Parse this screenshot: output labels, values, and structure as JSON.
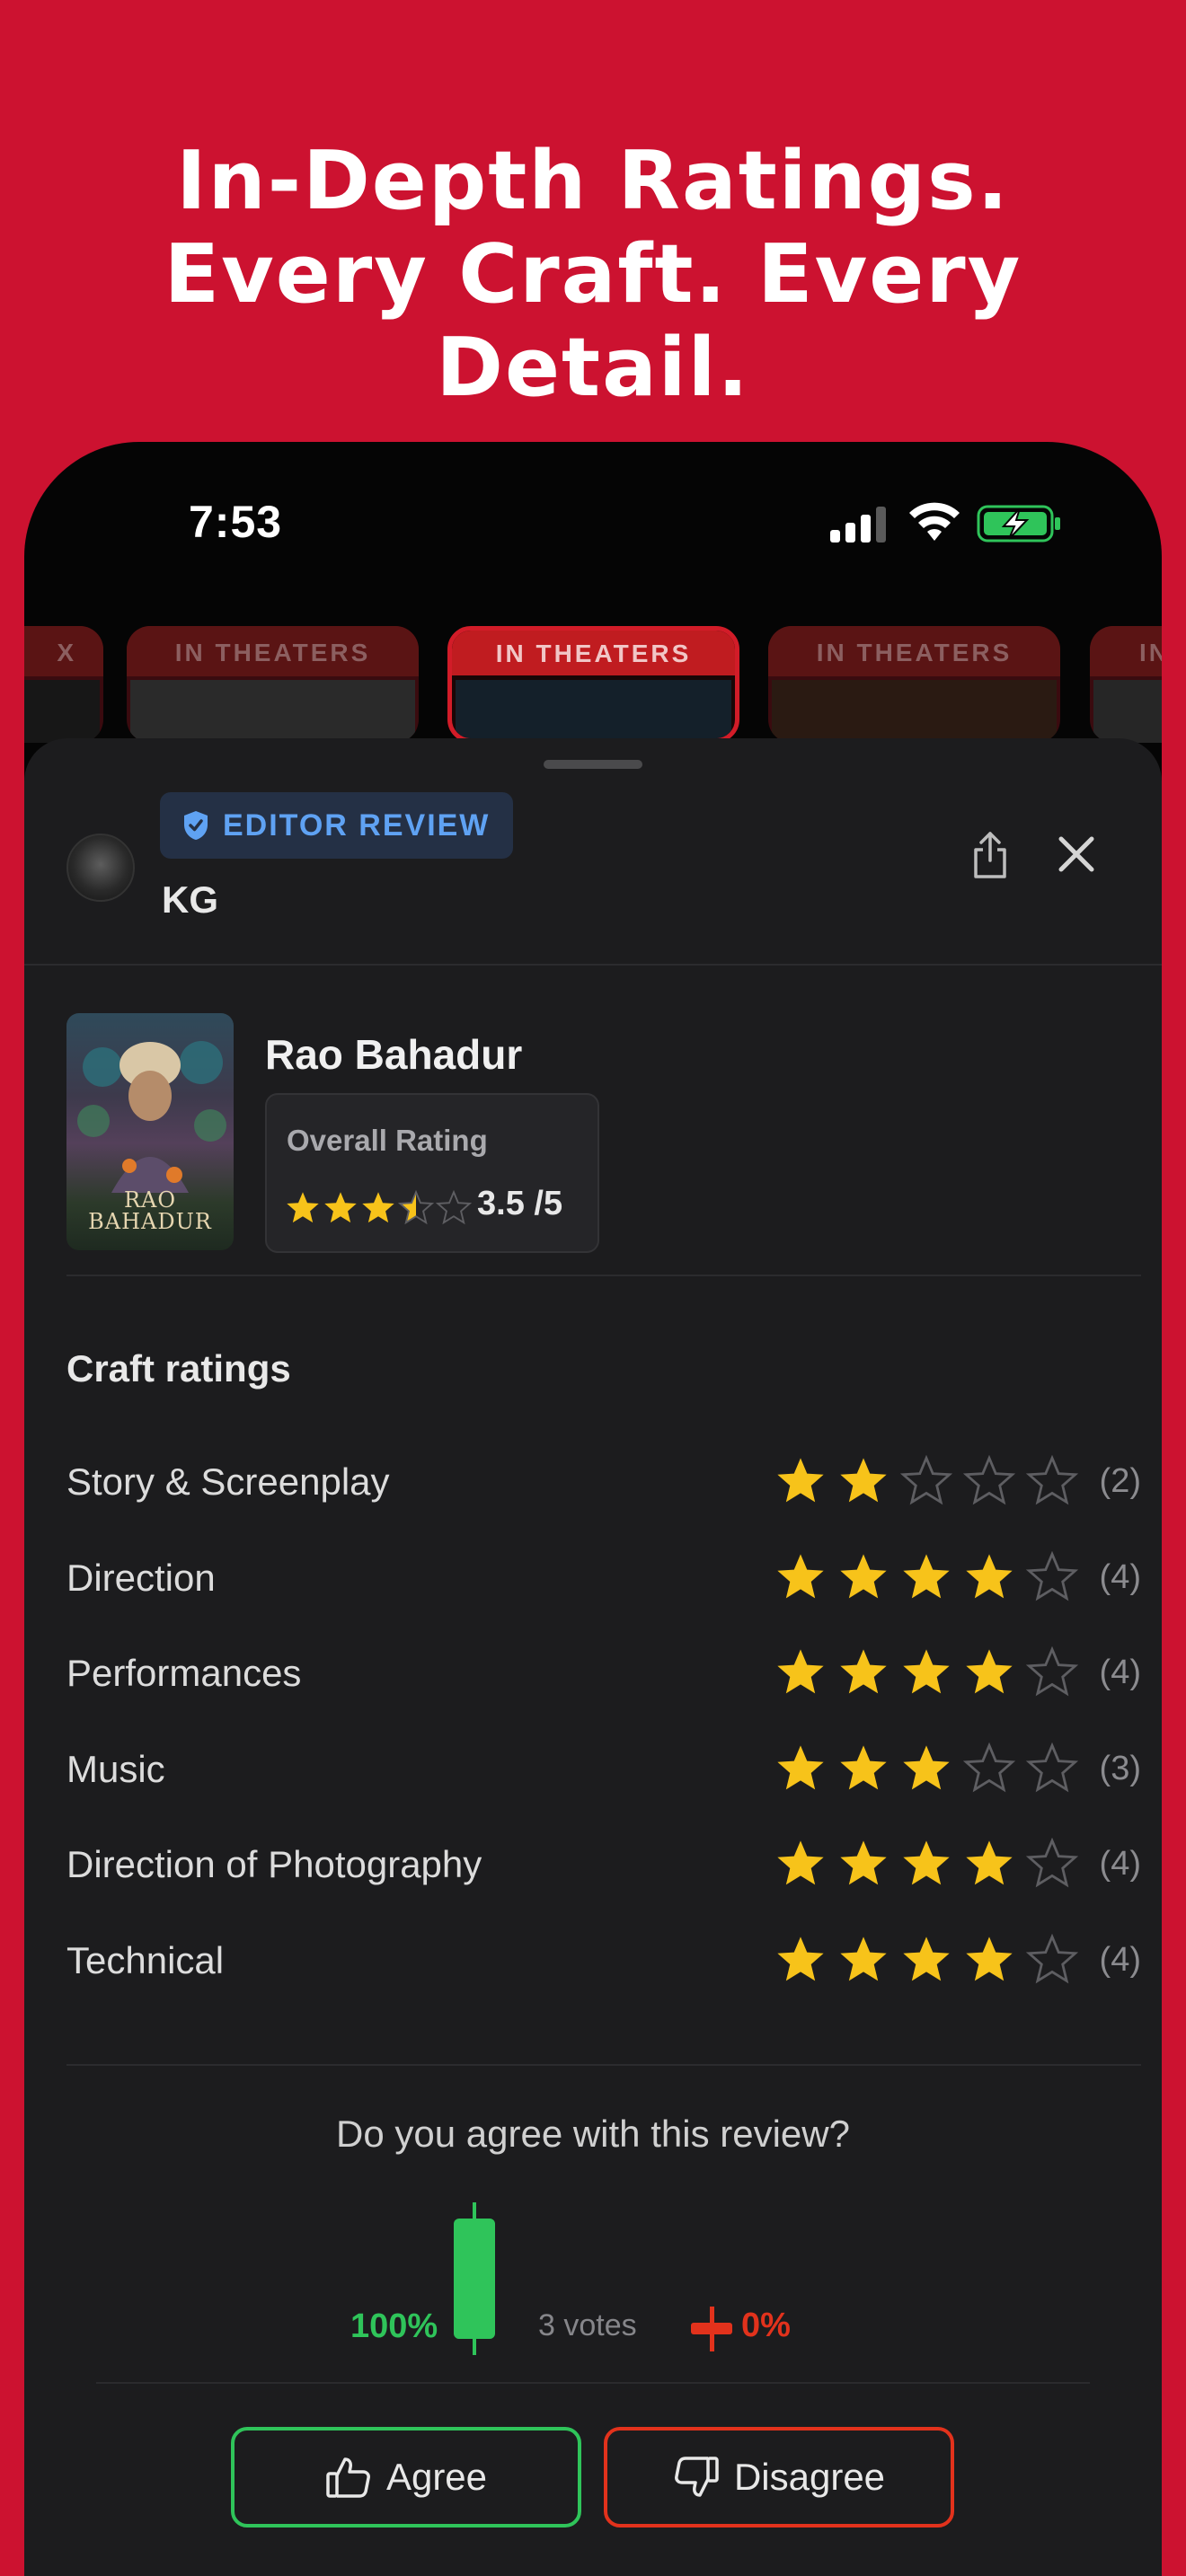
{
  "headline": {
    "line1": "In-Depth Ratings.",
    "line2": "Every Craft. Every",
    "line3": "Detail."
  },
  "status_bar": {
    "time": "7:53",
    "icons": [
      "cellular-signal-icon",
      "wifi-icon",
      "battery-charging-icon"
    ]
  },
  "carousel": {
    "tags": [
      "X",
      "IN THEATERS",
      "IN THEATERS",
      "IN THEATERS",
      "IN"
    ],
    "selected_index": 2
  },
  "review": {
    "badge": "EDITOR REVIEW",
    "author": "KG",
    "movie": {
      "title": "Rao Bahadur",
      "poster_text_line1": "RAO",
      "poster_text_line2": "BAHADUR",
      "overall_label": "Overall Rating",
      "overall_rating": 3.5,
      "overall_display": "3.5 /5"
    },
    "craft_title": "Craft ratings",
    "crafts": [
      {
        "name": "Story & Screenplay",
        "rating": 2,
        "count": "(2)"
      },
      {
        "name": "Direction",
        "rating": 4,
        "count": "(4)"
      },
      {
        "name": "Performances",
        "rating": 4,
        "count": "(4)"
      },
      {
        "name": "Music",
        "rating": 3,
        "count": "(3)"
      },
      {
        "name": "Direction of Photography",
        "rating": 4,
        "count": "(4)"
      },
      {
        "name": "Technical",
        "rating": 4,
        "count": "(4)"
      }
    ],
    "agreement": {
      "question": "Do you agree with this review?",
      "agree_pct": "100%",
      "disagree_pct": "0%",
      "votes": "3 votes"
    },
    "buttons": {
      "agree": "Agree",
      "disagree": "Disagree"
    }
  },
  "colors": {
    "background": "#cc1230",
    "sheet": "#1c1c1e",
    "star": "#f7c31a",
    "agree": "#2fc45a",
    "disagree": "#e2321c",
    "badge_text": "#5fa2f3"
  }
}
